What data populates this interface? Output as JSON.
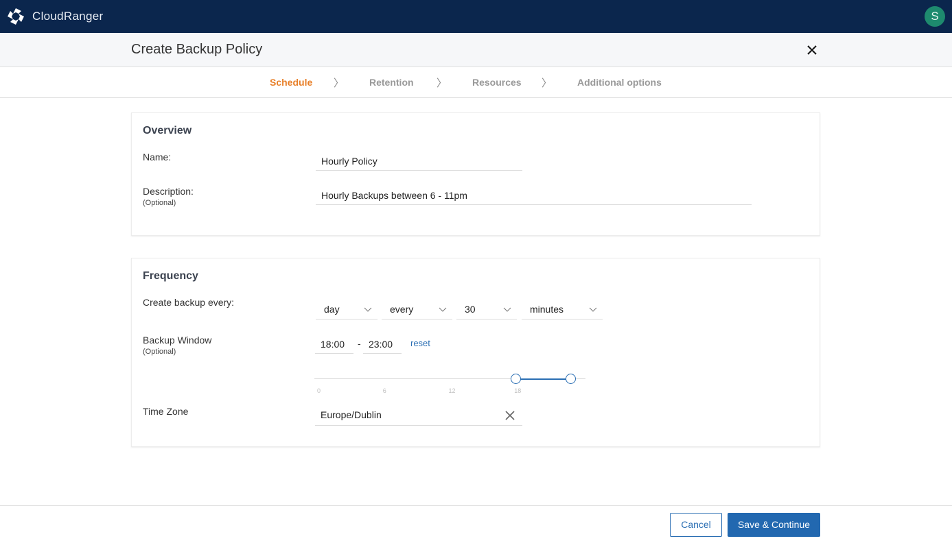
{
  "app": {
    "brand": "CloudRanger",
    "user_initial": "S",
    "accent": "#e8802a",
    "primary": "#2268b0"
  },
  "header": {
    "title": "Create Backup Policy"
  },
  "steps": [
    {
      "label": "Schedule",
      "active": true
    },
    {
      "label": "Retention",
      "active": false
    },
    {
      "label": "Resources",
      "active": false
    },
    {
      "label": "Additional options",
      "active": false
    }
  ],
  "step_separator": "〉",
  "overview": {
    "title": "Overview",
    "name_label": "Name:",
    "name_value": "Hourly Policy",
    "description_label": "Description:",
    "description_optional": "(Optional)",
    "description_value": "Hourly Backups between 6 - 11pm"
  },
  "frequency": {
    "title": "Frequency",
    "create_label": "Create backup every:",
    "selects": [
      "day",
      "every",
      "30",
      "minutes"
    ],
    "window_label": "Backup Window",
    "window_optional": "(Optional)",
    "window_start": "18:00",
    "window_end": "23:00",
    "window_dash": "-",
    "reset_label": "reset",
    "slider": {
      "min": 0,
      "max": 24,
      "start": 18,
      "end": 23,
      "ticks": [
        "0",
        "6",
        "12",
        "18"
      ]
    },
    "timezone_label": "Time Zone",
    "timezone_value": "Europe/Dublin"
  },
  "footer": {
    "cancel_label": "Cancel",
    "save_label": "Save & Continue"
  }
}
